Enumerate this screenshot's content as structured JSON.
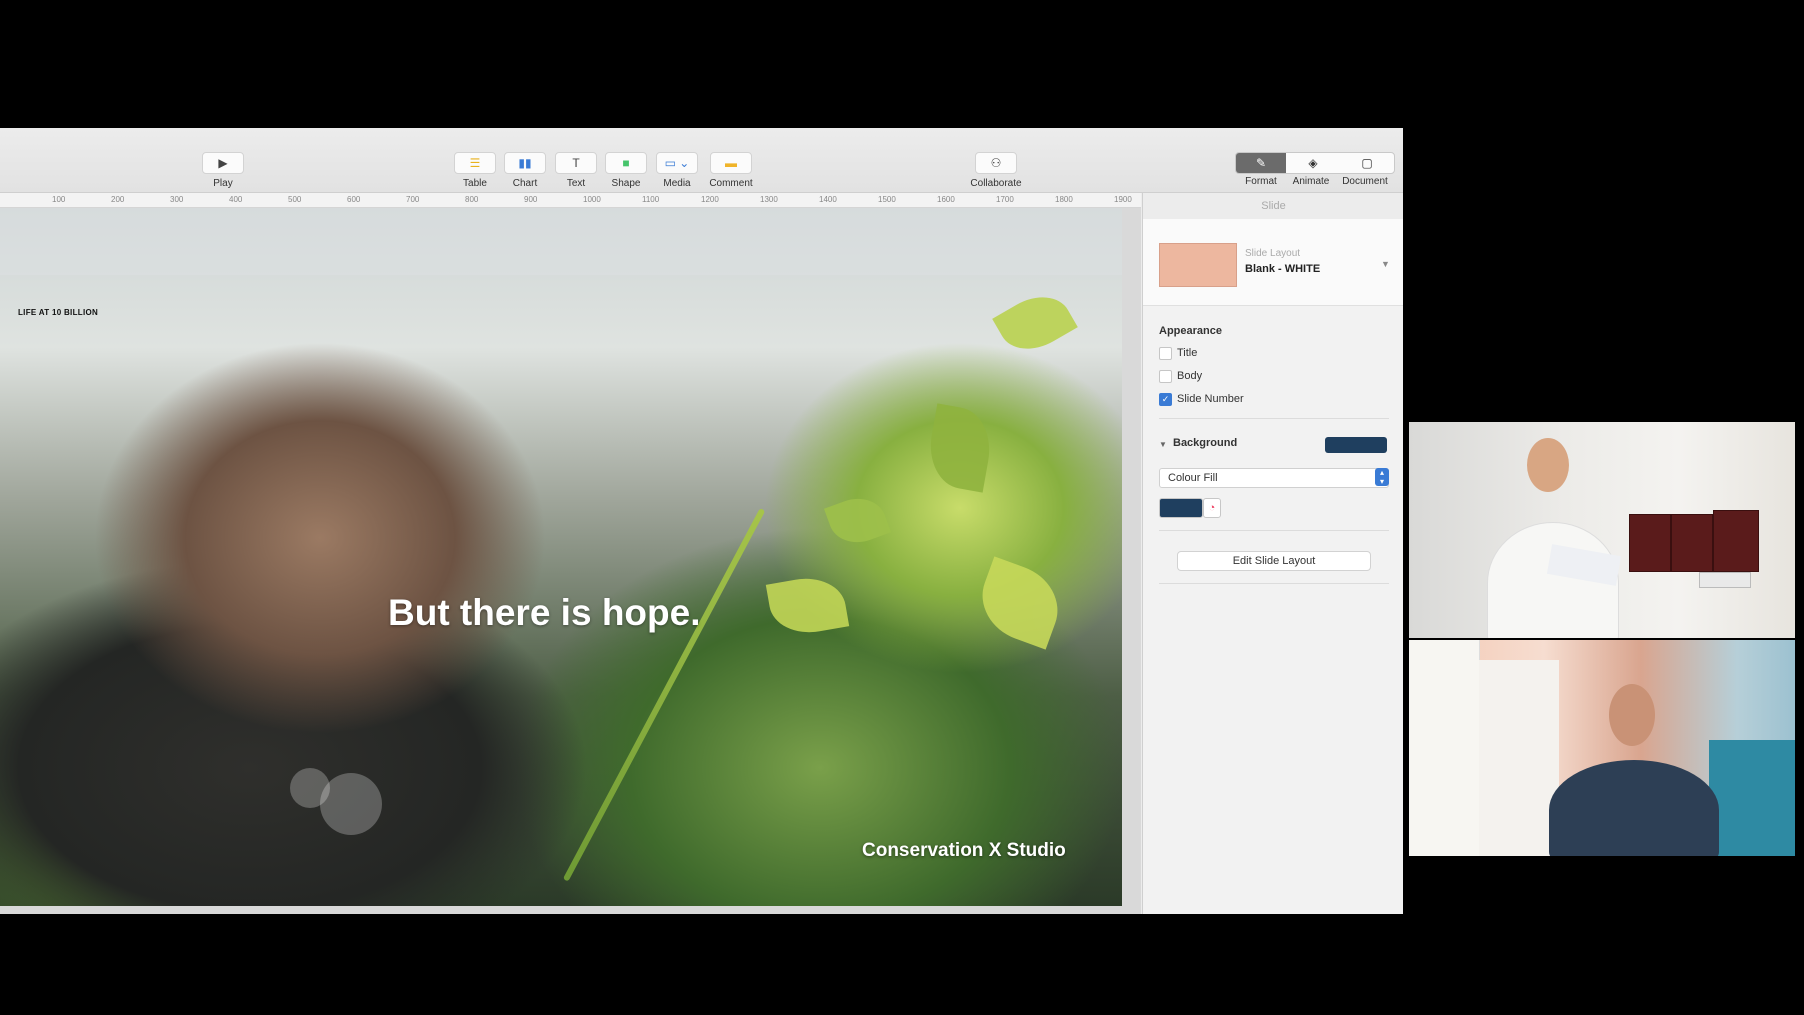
{
  "toolbar": {
    "play": {
      "label": "Play",
      "icon": "play-icon"
    },
    "table": {
      "label": "Table",
      "icon": "table-icon"
    },
    "chart": {
      "label": "Chart",
      "icon": "chart-icon"
    },
    "text": {
      "label": "Text",
      "icon": "text-icon"
    },
    "shape": {
      "label": "Shape",
      "icon": "shape-icon"
    },
    "media": {
      "label": "Media",
      "icon": "media-icon"
    },
    "comment": {
      "label": "Comment",
      "icon": "comment-icon"
    },
    "collaborate": {
      "label": "Collaborate",
      "icon": "collaborate-icon"
    },
    "format": {
      "label": "Format",
      "icon": "format-brush-icon"
    },
    "animate": {
      "label": "Animate",
      "icon": "animate-icon"
    },
    "document": {
      "label": "Document",
      "icon": "document-icon"
    }
  },
  "ruler": {
    "ticks": [
      "100",
      "200",
      "300",
      "400",
      "500",
      "600",
      "700",
      "800",
      "900",
      "1000",
      "1100",
      "1200",
      "1300",
      "1400",
      "1500",
      "1600",
      "1700",
      "1800",
      "1900"
    ]
  },
  "slide": {
    "tag": "LIFE AT 10 BILLION",
    "headline": "But there is hope.",
    "credit": "Conservation X Studio"
  },
  "inspector": {
    "title": "Slide",
    "layout_caption": "Slide Layout",
    "layout_name": "Blank - WHITE",
    "appearance": {
      "title": "Appearance",
      "options": [
        {
          "label": "Title",
          "checked": false
        },
        {
          "label": "Body",
          "checked": false
        },
        {
          "label": "Slide Number",
          "checked": true
        }
      ]
    },
    "background": {
      "title": "Background",
      "fill_type": "Colour Fill",
      "color": "#1f3f5f"
    },
    "edit_button": "Edit Slide Layout"
  },
  "colors": {
    "accent_blue": "#3a7bd5",
    "layout_thumb": "#edb79f",
    "background_fill": "#1f3f5f"
  }
}
